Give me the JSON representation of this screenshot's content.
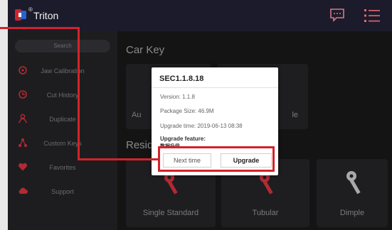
{
  "topbar": {
    "title": "Triton",
    "registered_mark": "®",
    "icons": [
      "logo-icon",
      "message-icon",
      "menu-icon"
    ]
  },
  "sidebar": {
    "search_label": "Search",
    "items": [
      {
        "label": "Jaw Calibration",
        "icon": "target-icon"
      },
      {
        "label": "Cut History",
        "icon": "history-icon"
      },
      {
        "label": "Duplicate",
        "icon": "person-icon"
      },
      {
        "label": "Custom Keys",
        "icon": "network-icon"
      },
      {
        "label": "Favorites",
        "icon": "heart-icon"
      },
      {
        "label": "Support",
        "icon": "cloud-icon"
      }
    ]
  },
  "main": {
    "section1_title": "Car Key",
    "section2_title": "Resid",
    "car_cards": [
      {
        "label": "Au"
      },
      {
        "label": "le"
      }
    ],
    "residential_cards": [
      {
        "label": "Single Standard"
      },
      {
        "label": "Tubular"
      },
      {
        "label": "Dimple"
      }
    ]
  },
  "dialog": {
    "title": "SEC1.1.8.18",
    "version": "Version: 1.1.8",
    "package_size": "Package Size: 46.9M",
    "upgrade_time": "Upgrade time: 2019-06-13 08:38",
    "feature_label": "Upgrade feature:",
    "feature_value": "数据升级",
    "next_label": "Next time",
    "upgrade_label": "Upgrade"
  },
  "colors": {
    "highlight": "#d2232a",
    "topbar": "#1c1b2b",
    "sidebar_icon": "#b12a34"
  }
}
